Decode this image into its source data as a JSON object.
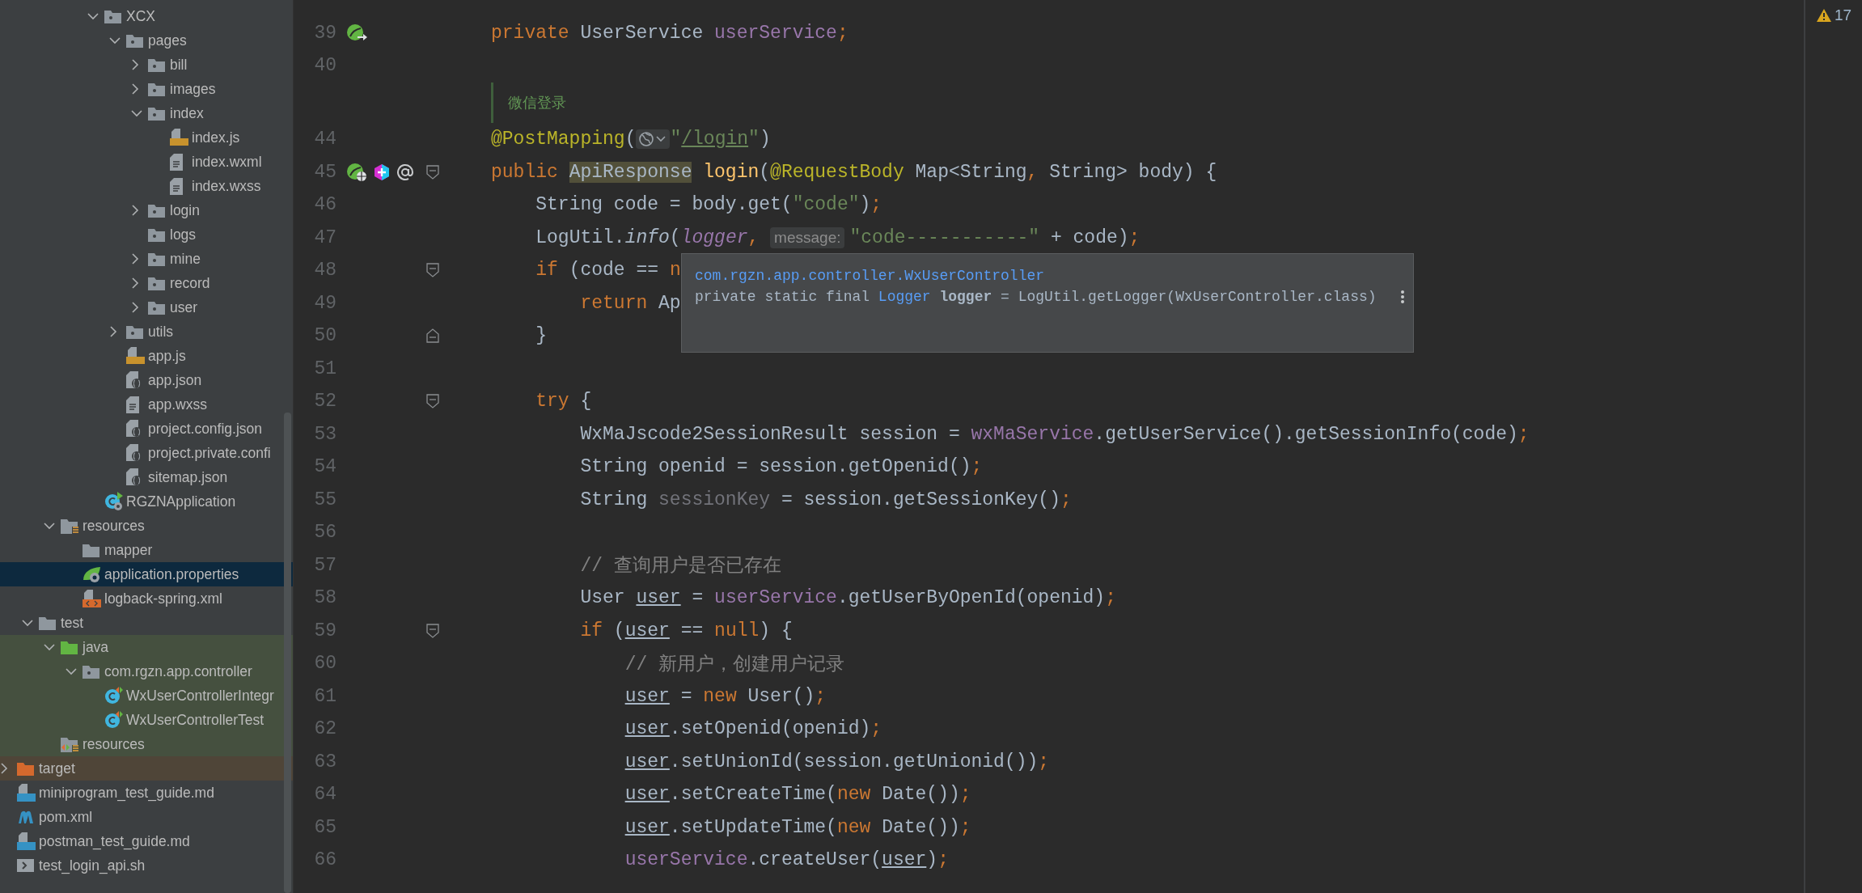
{
  "project_tree": {
    "items": [
      {
        "children": [
          {
            "children": [
              {
                "children": [
                  {
                    "children": [
                      {
                        "label": "XCX",
                        "kind": "package",
                        "expanded": true,
                        "selected": false,
                        "children": [
                          {
                            "label": "pages",
                            "kind": "package",
                            "expanded": true,
                            "selected": false,
                            "children": [
                              {
                                "label": "bill",
                                "kind": "package",
                                "expanded": false,
                                "selected": false
                              },
                              {
                                "label": "images",
                                "kind": "package",
                                "expanded": false,
                                "selected": false
                              },
                              {
                                "label": "index",
                                "kind": "package",
                                "expanded": true,
                                "selected": false,
                                "children": [
                                  {
                                    "label": "index.js",
                                    "kind": "js",
                                    "selected": false
                                  },
                                  {
                                    "label": "index.wxml",
                                    "kind": "text",
                                    "selected": false
                                  },
                                  {
                                    "label": "index.wxss",
                                    "kind": "text",
                                    "selected": false
                                  }
                                ]
                              },
                              {
                                "label": "login",
                                "kind": "package",
                                "expanded": false,
                                "selected": false
                              },
                              {
                                "label": "logs",
                                "kind": "package",
                                "selected": false
                              },
                              {
                                "label": "mine",
                                "kind": "package",
                                "expanded": false,
                                "selected": false
                              },
                              {
                                "label": "record",
                                "kind": "package",
                                "expanded": false,
                                "selected": false
                              },
                              {
                                "label": "user",
                                "kind": "package",
                                "expanded": false,
                                "selected": false
                              }
                            ]
                          },
                          {
                            "label": "utils",
                            "kind": "package",
                            "expanded": false,
                            "selected": false
                          },
                          {
                            "label": "app.js",
                            "kind": "js",
                            "selected": false
                          },
                          {
                            "label": "app.json",
                            "kind": "json",
                            "selected": false
                          },
                          {
                            "label": "app.wxss",
                            "kind": "text",
                            "selected": false
                          },
                          {
                            "label": "project.config.json",
                            "kind": "json",
                            "selected": false
                          },
                          {
                            "label": "project.private.confi",
                            "kind": "json",
                            "selected": false
                          },
                          {
                            "label": "sitemap.json",
                            "kind": "json",
                            "selected": false
                          }
                        ]
                      },
                      {
                        "label": "RGZNApplication",
                        "kind": "app_class",
                        "selected": false
                      }
                    ]
                  }
                ]
              },
              {
                "label": "resources",
                "kind": "resources",
                "expanded": true,
                "selected": false,
                "children": [
                  {
                    "label": "mapper",
                    "kind": "folder",
                    "selected": false
                  },
                  {
                    "label": "application.properties",
                    "kind": "spring_props",
                    "selected": true
                  },
                  {
                    "label": "logback-spring.xml",
                    "kind": "xml",
                    "selected": false
                  }
                ]
              }
            ]
          },
          {
            "label": "test",
            "kind": "folder",
            "expanded": true,
            "selected": false,
            "children": [
              {
                "label": "java",
                "kind": "test_src",
                "expanded": true,
                "selected": false,
                "children": [
                  {
                    "label": "com.rgzn.app.controller",
                    "kind": "package",
                    "expanded": true,
                    "selected": false,
                    "children": [
                      {
                        "label": "WxUserControllerIntegr",
                        "kind": "test_class",
                        "selected": false
                      },
                      {
                        "label": "WxUserControllerTest",
                        "kind": "test_class",
                        "selected": false
                      }
                    ]
                  }
                ]
              },
              {
                "label": "resources",
                "kind": "test_resources",
                "selected": false
              }
            ]
          }
        ]
      },
      {
        "label": "target",
        "kind": "excluded",
        "expanded": false,
        "selected": false
      },
      {
        "label": "miniprogram_test_guide.md",
        "kind": "md",
        "selected": false
      },
      {
        "label": "pom.xml",
        "kind": "maven",
        "selected": false
      },
      {
        "label": "postman_test_guide.md",
        "kind": "md",
        "selected": false
      },
      {
        "label": "test_login_api.sh",
        "kind": "shell",
        "selected": false
      }
    ]
  },
  "editor": {
    "lines": [
      {
        "number": "39",
        "markers": [
          {
            "kind": "bean_nav"
          }
        ],
        "tokens": [
          {
            "text": "private ",
            "kind": "kw"
          },
          {
            "text": "UserService ",
            "kind": "plain"
          },
          {
            "text": "userService",
            "kind": "field"
          },
          {
            "text": ";",
            "kind": "kw"
          }
        ]
      },
      {
        "number": "40"
      },
      {
        "kind": "doc",
        "text": "微信登录"
      },
      {
        "number": "44",
        "tokens": [
          {
            "text": "@PostMapping",
            "kind": "ann"
          },
          {
            "text": "(",
            "kind": "plain"
          },
          {
            "kind": "globe"
          },
          {
            "text": "\"",
            "kind": "str"
          },
          {
            "text": "/login",
            "kind": "link_str"
          },
          {
            "text": "\"",
            "kind": "str"
          },
          {
            "text": ")",
            "kind": "plain"
          }
        ]
      },
      {
        "number": "45",
        "fold": {
          "kind": "start"
        },
        "markers": [
          {
            "kind": "bean_web"
          },
          {
            "kind": "plus"
          },
          {
            "kind": "at"
          }
        ],
        "tokens": [
          {
            "text": "public ",
            "kind": "kw"
          },
          {
            "text": "ApiResponse",
            "kind": "highlight"
          },
          {
            "text": " login",
            "kind": "decl"
          },
          {
            "text": "(",
            "kind": "plain"
          },
          {
            "text": "@RequestBody",
            "kind": "ann"
          },
          {
            "text": " Map<String",
            "kind": "plain"
          },
          {
            "text": ",",
            "kind": "kw"
          },
          {
            "text": " String> body) {",
            "kind": "plain"
          }
        ]
      },
      {
        "number": "46",
        "tokens": [
          {
            "text": "    String code = body.get(",
            "kind": "plain"
          },
          {
            "text": "\"code\"",
            "kind": "str"
          },
          {
            "text": ")",
            "kind": "plain"
          },
          {
            "text": ";",
            "kind": "kw"
          }
        ]
      },
      {
        "number": "47",
        "tokens": [
          {
            "text": "    LogUtil.",
            "kind": "plain"
          },
          {
            "text": "info",
            "kind": "italic"
          },
          {
            "text": "(",
            "kind": "plain"
          },
          {
            "text": "logger",
            "kind": "static_field"
          },
          {
            "text": ", ",
            "kind": "kw"
          },
          {
            "text": "message:",
            "kind": "hint"
          },
          {
            "text": "\"code-----------\"",
            "kind": "str"
          },
          {
            "text": " + code)",
            "kind": "plain"
          },
          {
            "text": ";",
            "kind": "kw"
          }
        ]
      },
      {
        "number": "48",
        "fold": {
          "kind": "start"
        },
        "tokens": [
          {
            "text": "    if",
            "kind": "kw"
          },
          {
            "text": " (code == ",
            "kind": "plain"
          },
          {
            "text": "n",
            "kind": "kw"
          }
        ]
      },
      {
        "number": "49",
        "tokens": [
          {
            "text": "        return",
            "kind": "kw"
          },
          {
            "text": " Ap",
            "kind": "plain"
          }
        ]
      },
      {
        "number": "50",
        "fold": {
          "kind": "end"
        },
        "tokens": [
          {
            "text": "    }",
            "kind": "plain"
          }
        ]
      },
      {
        "number": "51"
      },
      {
        "number": "52",
        "fold": {
          "kind": "start"
        },
        "tokens": [
          {
            "text": "    try",
            "kind": "kw"
          },
          {
            "text": " {",
            "kind": "plain"
          }
        ]
      },
      {
        "number": "53",
        "tokens": [
          {
            "text": "        WxMaJscode2SessionResult session = ",
            "kind": "plain"
          },
          {
            "text": "wxMaService",
            "kind": "field"
          },
          {
            "text": ".getUserService().getSessionInfo(code)",
            "kind": "plain"
          },
          {
            "text": ";",
            "kind": "kw"
          }
        ]
      },
      {
        "number": "54",
        "tokens": [
          {
            "text": "        String openid = session.getOpenid()",
            "kind": "plain"
          },
          {
            "text": ";",
            "kind": "kw"
          }
        ]
      },
      {
        "number": "55",
        "tokens": [
          {
            "text": "        String ",
            "kind": "plain"
          },
          {
            "text": "sessionKey",
            "kind": "unused"
          },
          {
            "text": " = session.getSessionKey()",
            "kind": "plain"
          },
          {
            "text": ";",
            "kind": "kw"
          }
        ]
      },
      {
        "number": "56"
      },
      {
        "number": "57",
        "tokens": [
          {
            "text": "        // 查询用户是否已存在",
            "kind": "comment"
          }
        ]
      },
      {
        "number": "58",
        "tokens": [
          {
            "text": "        User ",
            "kind": "plain"
          },
          {
            "text": "user",
            "kind": "var"
          },
          {
            "text": " = ",
            "kind": "plain"
          },
          {
            "text": "userService",
            "kind": "field"
          },
          {
            "text": ".getUserByOpenId(openid)",
            "kind": "plain"
          },
          {
            "text": ";",
            "kind": "kw"
          }
        ]
      },
      {
        "number": "59",
        "fold": {
          "kind": "start"
        },
        "tokens": [
          {
            "text": "        if",
            "kind": "kw"
          },
          {
            "text": " (",
            "kind": "plain"
          },
          {
            "text": "user",
            "kind": "var"
          },
          {
            "text": " == ",
            "kind": "plain"
          },
          {
            "text": "null",
            "kind": "kw"
          },
          {
            "text": ") {",
            "kind": "plain"
          }
        ]
      },
      {
        "number": "60",
        "tokens": [
          {
            "text": "            // 新用户，创建用户记录",
            "kind": "comment"
          }
        ]
      },
      {
        "number": "61",
        "tokens": [
          {
            "text": "            user",
            "kind": "var"
          },
          {
            "text": " = ",
            "kind": "plain"
          },
          {
            "text": "new",
            "kind": "kw"
          },
          {
            "text": " User()",
            "kind": "plain"
          },
          {
            "text": ";",
            "kind": "kw"
          }
        ]
      },
      {
        "number": "62",
        "tokens": [
          {
            "text": "            user",
            "kind": "var"
          },
          {
            "text": ".setOpenid(openid)",
            "kind": "plain"
          },
          {
            "text": ";",
            "kind": "kw"
          }
        ]
      },
      {
        "number": "63",
        "tokens": [
          {
            "text": "            user",
            "kind": "var"
          },
          {
            "text": ".setUnionId(session.getUnionid())",
            "kind": "plain"
          },
          {
            "text": ";",
            "kind": "kw"
          }
        ]
      },
      {
        "number": "64",
        "tokens": [
          {
            "text": "            user",
            "kind": "var"
          },
          {
            "text": ".setCreateTime(",
            "kind": "plain"
          },
          {
            "text": "new",
            "kind": "kw"
          },
          {
            "text": " Date())",
            "kind": "plain"
          },
          {
            "text": ";",
            "kind": "kw"
          }
        ]
      },
      {
        "number": "65",
        "tokens": [
          {
            "text": "            user",
            "kind": "var"
          },
          {
            "text": ".setUpdateTime(",
            "kind": "plain"
          },
          {
            "text": "new",
            "kind": "kw"
          },
          {
            "text": " Date())",
            "kind": "plain"
          },
          {
            "text": ";",
            "kind": "kw"
          }
        ]
      },
      {
        "number": "66",
        "tokens": [
          {
            "text": "            userService",
            "kind": "field"
          },
          {
            "text": ".createUser(",
            "kind": "plain"
          },
          {
            "text": "user",
            "kind": "var"
          },
          {
            "text": ")",
            "kind": "plain"
          },
          {
            "text": ";",
            "kind": "kw"
          }
        ]
      }
    ],
    "tooltip": {
      "header": "com.rgzn.app.controller.WxUserController",
      "declaration": [
        {
          "text": "private static final ",
          "kind": "plain"
        },
        {
          "text": "Logger",
          "kind": "type"
        },
        {
          "text": " logger",
          "kind": "bold"
        },
        {
          "text": " = LogUtil.getLogger(WxUserController.class)",
          "kind": "plain"
        }
      ]
    }
  },
  "inspections": {
    "warnings": "17"
  }
}
